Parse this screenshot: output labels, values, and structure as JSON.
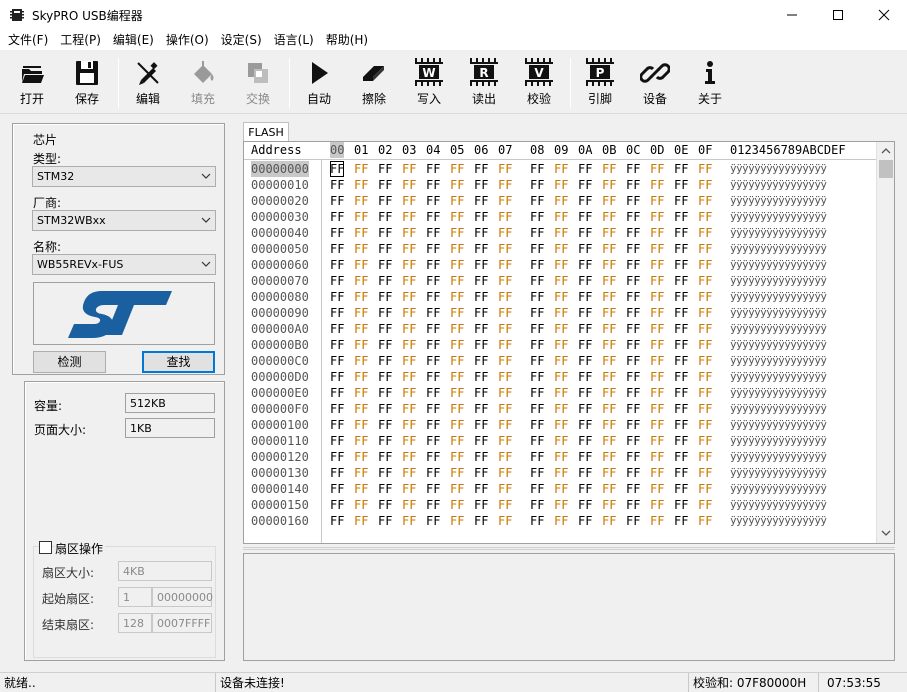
{
  "window": {
    "title": "SkyPRO USB编程器"
  },
  "menu": [
    "文件(F)",
    "工程(P)",
    "编辑(E)",
    "操作(O)",
    "设定(S)",
    "语言(L)",
    "帮助(H)"
  ],
  "toolbar": [
    {
      "label": "打开",
      "icon": "open-icon",
      "enabled": true
    },
    {
      "label": "保存",
      "icon": "save-icon",
      "enabled": true
    },
    {
      "label": "编辑",
      "icon": "edit-icon",
      "enabled": true
    },
    {
      "label": "填充",
      "icon": "fill-icon",
      "enabled": false
    },
    {
      "label": "交换",
      "icon": "swap-icon",
      "enabled": false
    },
    {
      "label": "自动",
      "icon": "auto-icon",
      "enabled": true
    },
    {
      "label": "擦除",
      "icon": "erase-icon",
      "enabled": true
    },
    {
      "label": "写入",
      "icon": "write-icon",
      "enabled": true,
      "glyph": "W"
    },
    {
      "label": "读出",
      "icon": "read-icon",
      "enabled": true,
      "glyph": "R"
    },
    {
      "label": "校验",
      "icon": "verify-icon",
      "enabled": true,
      "glyph": "V"
    },
    {
      "label": "引脚",
      "icon": "pin-icon",
      "enabled": true,
      "glyph": "P"
    },
    {
      "label": "设备",
      "icon": "device-icon",
      "enabled": true
    },
    {
      "label": "关于",
      "icon": "about-icon",
      "enabled": true
    }
  ],
  "chip": {
    "group_title": "芯片",
    "type_label": "类型:",
    "type_value": "STM32",
    "vendor_label": "厂商:",
    "vendor_value": "STM32WBxx",
    "name_label": "名称:",
    "name_value": "WB55REVx-FUS",
    "detect_button": "检测",
    "find_button": "查找",
    "logo_text": "ST"
  },
  "info": {
    "capacity_label": "容量:",
    "capacity_value": "512KB",
    "page_label": "页面大小:",
    "page_value": "1KB",
    "sector_checkbox": "扇区操作",
    "sector_size_label": "扇区大小:",
    "sector_size_value": "4KB",
    "start_label": "起始扇区:",
    "start_value": "1",
    "start_addr": "00000000",
    "end_label": "结束扇区:",
    "end_value": "128",
    "end_addr": "0007FFFF"
  },
  "hex": {
    "tab": "FLASH",
    "address_header": "Address",
    "columns": [
      "00",
      "01",
      "02",
      "03",
      "04",
      "05",
      "06",
      "07",
      "08",
      "09",
      "0A",
      "0B",
      "0C",
      "0D",
      "0E",
      "0F"
    ],
    "ascii_header": "0123456789ABCDEF",
    "byte_value": "FF",
    "ascii_row": "ÿÿÿÿÿÿÿÿÿÿÿÿÿÿÿÿ",
    "addresses": [
      "00000000",
      "00000010",
      "00000020",
      "00000030",
      "00000040",
      "00000050",
      "00000060",
      "00000070",
      "00000080",
      "00000090",
      "000000A0",
      "000000B0",
      "000000C0",
      "000000D0",
      "000000E0",
      "000000F0",
      "00000100",
      "00000110",
      "00000120",
      "00000130",
      "00000140",
      "00000150",
      "00000160"
    ],
    "highlight_color": "#c87800"
  },
  "status": {
    "ready": "就绪..",
    "connection": "设备未连接!",
    "checksum": "校验和: 07F80000H",
    "time": "07:53:55"
  }
}
